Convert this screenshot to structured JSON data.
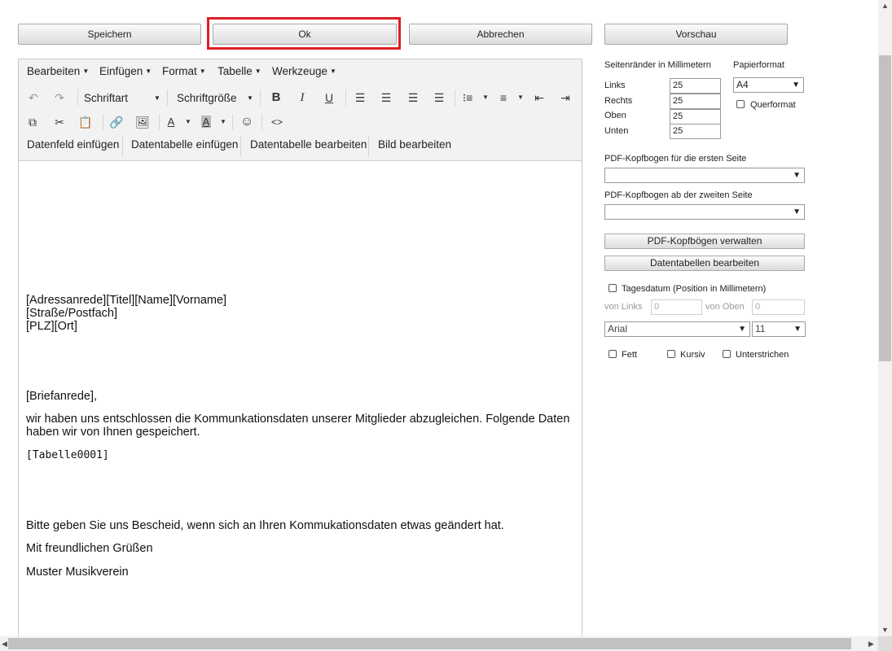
{
  "buttons": {
    "save": "Speichern",
    "ok": "Ok",
    "cancel": "Abbrechen",
    "preview": "Vorschau"
  },
  "editor": {
    "menu": [
      "Bearbeiten",
      "Einfügen",
      "Format",
      "Tabelle",
      "Werkzeuge"
    ],
    "font_family_placeholder": "Schriftart",
    "font_size_placeholder": "Schriftgröße",
    "insert_buttons": [
      "Datenfeld einfügen",
      "Datentabelle einfügen",
      "Datentabelle bearbeiten",
      "Bild bearbeiten"
    ],
    "content": {
      "address_line1": "[Adressanrede][Titel][Name][Vorname]",
      "address_line2": "[Straße/Postfach]",
      "address_line3": "[PLZ][Ort]",
      "salutation": "[Briefanrede],",
      "body": "wir haben uns entschlossen die Kommunkationsdaten unserer Mitglieder abzugleichen. Folgende Daten haben wir von Ihnen gespeichert.",
      "table_placeholder": "[Tabelle0001]",
      "closing_request": "Bitte geben Sie uns Bescheid, wenn sich an Ihren Kommukationsdaten etwas geändert hat.",
      "regards": "Mit freundlichen Grüßen",
      "sender": "Muster Musikverein"
    }
  },
  "panel": {
    "margins_title": "Seitenränder in Millimetern",
    "paper_title": "Papierformat",
    "left_label": "Links",
    "right_label": "Rechts",
    "top_label": "Oben",
    "bottom_label": "Unten",
    "left_value": "25",
    "right_value": "25",
    "top_value": "25",
    "bottom_value": "25",
    "paper_value": "A4",
    "landscape_label": "Querformat",
    "letterhead_first_label": "PDF-Kopfbogen für die ersten Seite",
    "letterhead_second_label": "PDF-Kopfbogen ab der zweiten Seite",
    "manage_letterheads": "PDF-Kopfbögen verwalten",
    "edit_datatables": "Datentabellen bearbeiten",
    "date_label": "Tagesdatum (Position in Millimetern)",
    "from_left_label": "von Links",
    "from_top_label": "von Oben",
    "from_left_value": "0",
    "from_top_value": "0",
    "font_value": "Arial",
    "size_value": "11",
    "bold_label": "Fett",
    "italic_label": "Kursiv",
    "underline_label": "Unterstrichen"
  }
}
